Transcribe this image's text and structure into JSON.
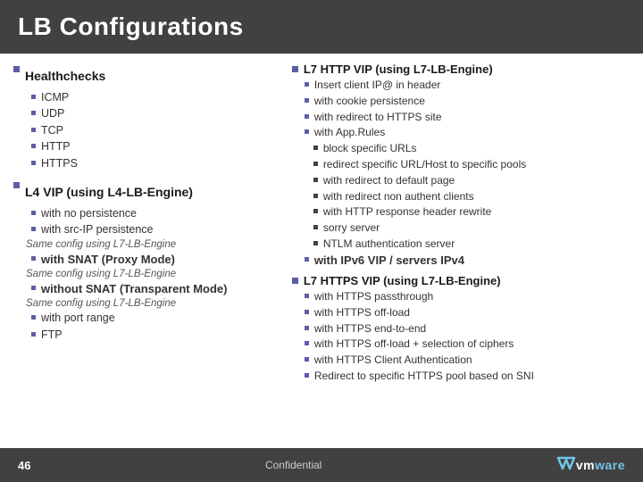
{
  "header": {
    "title": "LB Configurations"
  },
  "left_column": {
    "section1": {
      "title": "Healthchecks",
      "items": [
        "ICMP",
        "UDP",
        "TCP",
        "HTTP",
        "HTTPS"
      ]
    },
    "section2": {
      "title": "L4 VIP (using L4-LB-Engine)",
      "items": [
        "with no persistence",
        "with src-IP persistence"
      ],
      "note1": "Same config using L7-LB-Engine",
      "item3": "with SNAT (Proxy Mode)",
      "note2": "Same config using L7-LB-Engine",
      "item4": "without SNAT (Transparent Mode)",
      "note3": "Same config using L7-LB-Engine",
      "item5": "with port range",
      "item6": "FTP"
    }
  },
  "right_column": {
    "section1": {
      "title": "L7 HTTP VIP (using L7-LB-Engine)",
      "items": [
        "Insert client IP@ in header",
        "with cookie persistence",
        "with redirect to HTTPS site",
        "with App.Rules"
      ],
      "sub_items": [
        "block specific URLs",
        "redirect specific URL/Host to specific pools",
        "with redirect to default page",
        "with redirect non authent clients",
        "with HTTP response header rewrite",
        "sorry server",
        "NTLM authentication server"
      ],
      "extra": "with IPv6 VIP / servers IPv4"
    },
    "section2": {
      "title": "L7 HTTPS VIP (using L7-LB-Engine)",
      "items": [
        "with HTTPS passthrough",
        "with HTTPS off-load",
        "with HTTPS end-to-end",
        "with HTTPS off-load + selection of ciphers",
        "with HTTPS Client Authentication",
        "Redirect to specific HTTPS pool based on SNI"
      ]
    }
  },
  "footer": {
    "page": "46",
    "confidential": "Confidential",
    "logo": "vmware"
  }
}
